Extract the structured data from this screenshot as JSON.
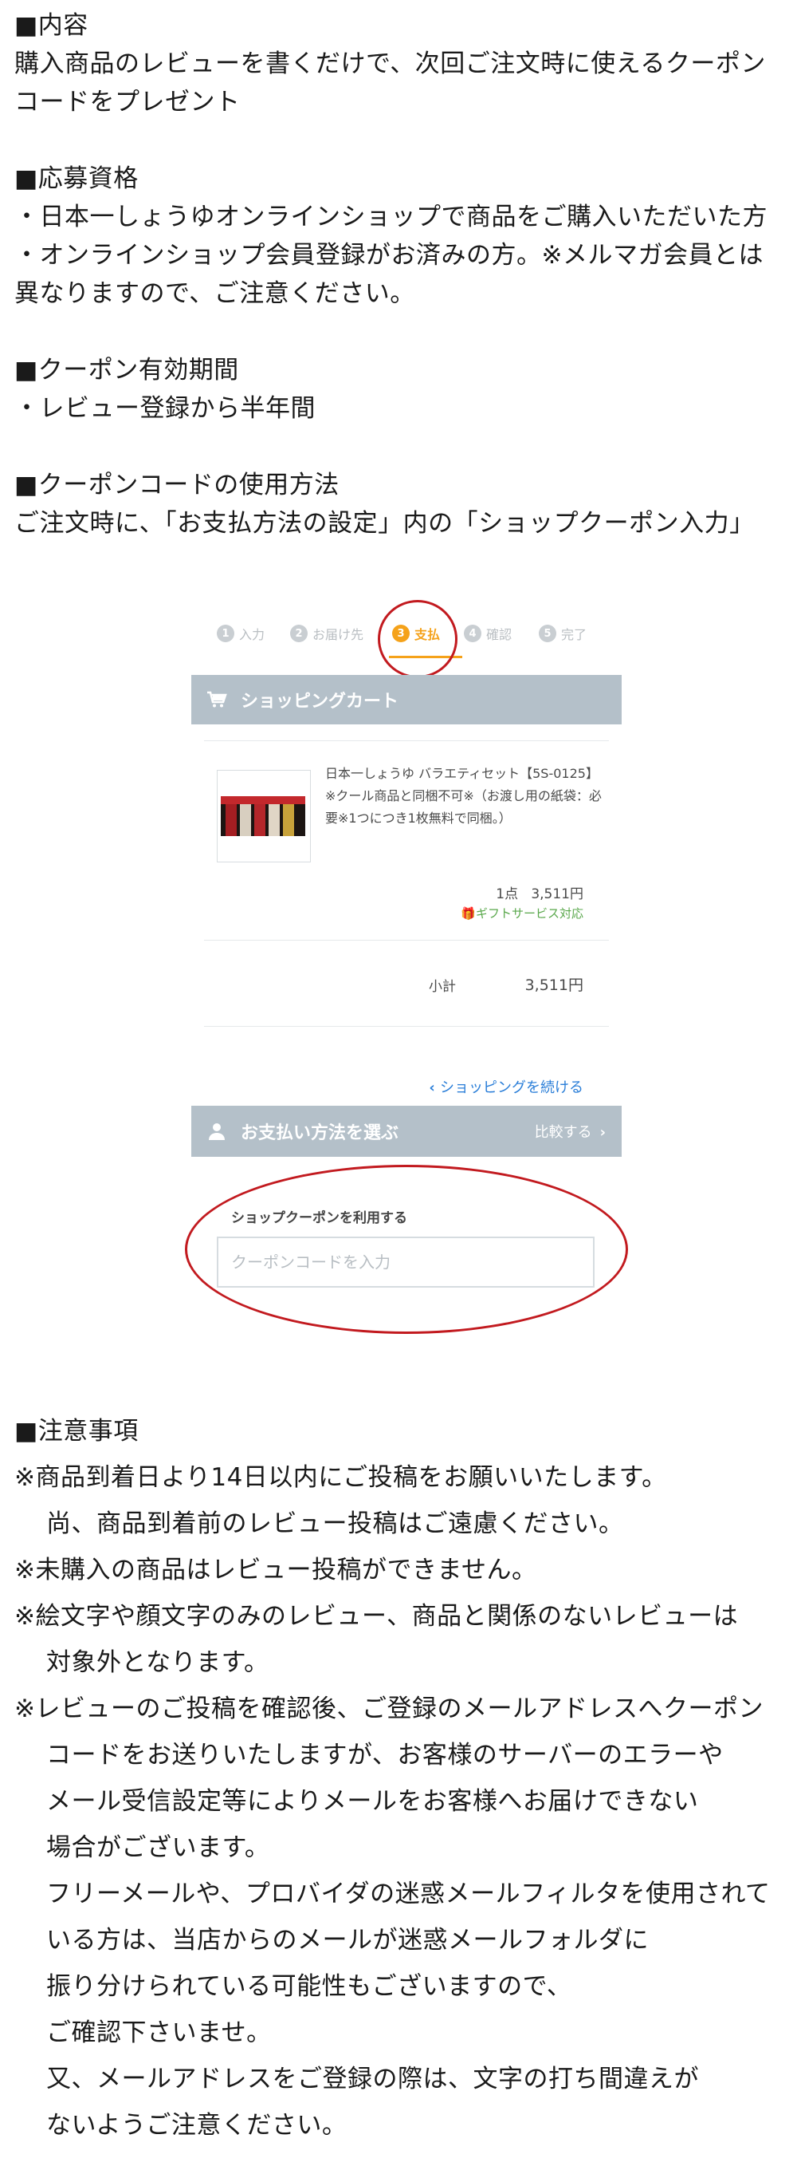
{
  "content": {
    "heading": "■内容",
    "lines": [
      "購入商品のレビューを書くだけで、次回ご注文時に使えるクーポン",
      "コードをプレゼント"
    ]
  },
  "eligibility": {
    "heading": "■応募資格",
    "lines": [
      "・日本一しょうゆオンラインショップで商品をご購入いただいた方",
      "・オンラインショップ会員登録がお済みの方。※メルマガ会員とは",
      "異なりますので、ご注意ください。"
    ]
  },
  "validity": {
    "heading": "■クーポン有効期間",
    "lines": [
      "・レビュー登録から半年間"
    ]
  },
  "usage": {
    "heading": "■クーポンコードの使用方法",
    "lines": [
      "ご注文時に、「お支払方法の設定」内の「ショップクーポン入力」"
    ]
  },
  "mock": {
    "steps": [
      {
        "num": "1",
        "label": "入力"
      },
      {
        "num": "2",
        "label": "お届け先"
      },
      {
        "num": "3",
        "label": "支払"
      },
      {
        "num": "4",
        "label": "確認"
      },
      {
        "num": "5",
        "label": "完了"
      }
    ],
    "active_step": 3,
    "cart_title": "ショッピングカート",
    "product_desc": "日本一しょうゆ バラエティセット【5S-0125】 ※クール商品と同梱不可※（お渡し用の紙袋：必要※1つにつき1枚無料で同梱。）",
    "qty_price": "1点   3,511円",
    "gift_label": "ギフトサービス対応",
    "subtotal_label": "小計",
    "subtotal_value": "3,511円",
    "continue_link": "ショッピングを続ける",
    "payment_title": "お支払い方法を選ぶ",
    "compare_label": "比較する",
    "coupon_label": "ショップクーポンを利用する",
    "coupon_placeholder": "クーポンコードを入力",
    "colors": {
      "accent": "#f5a21a",
      "bar": "#b4c0c9",
      "link": "#2a7ed8",
      "gift": "#5aa84c",
      "highlight_ring": "#c21a1f"
    }
  },
  "notes": {
    "heading": "■注意事項",
    "lines": [
      "※商品到着日より14日以内にご投稿をお願いいたします。",
      "尚、商品到着前のレビュー投稿はご遠慮ください。",
      "※未購入の商品はレビュー投稿ができません。",
      "※絵文字や顔文字のみのレビュー、商品と関係のないレビューは",
      "対象外となります。",
      "※レビューのご投稿を確認後、ご登録のメールアドレスへクーポン",
      "コードをお送りいたしますが、お客様のサーバーのエラーや",
      "メール受信設定等によりメールをお客様へお届けできない",
      "場合がございます。",
      "フリーメールや、プロバイダの迷惑メールフィルタを使用されて",
      "いる方は、当店からのメールが迷惑メールフォルダに",
      "振り分けられている可能性もございますので、",
      "ご確認下さいませ。",
      "又、メールアドレスをご登録の際は、文字の打ち間違えが",
      "ないようご注意ください。"
    ]
  }
}
